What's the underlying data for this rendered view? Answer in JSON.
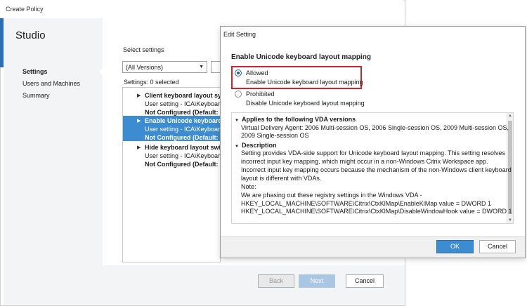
{
  "create_policy": {
    "title": "Create Policy",
    "brand": "Studio",
    "nav": [
      {
        "label": "Settings"
      },
      {
        "label": "Users and Machines"
      },
      {
        "label": "Summary"
      }
    ],
    "select_settings_label": "Select settings",
    "versions_select_value": "(All Versions)",
    "settings_count": "Settings: 0 selected",
    "list_items": [
      {
        "name": "Client keyboard layout syn",
        "sub": "User setting - ICA\\Keyboard",
        "config": "Not Configured (Default: Di"
      },
      {
        "name": "Enable Unicode keyboard",
        "sub": "User setting - ICA\\Keyboard",
        "config": "Not Configured (Default: Pr"
      },
      {
        "name": "Hide keyboard layout swit",
        "sub": "User setting - ICA\\Keyboard",
        "config": "Not Configured (Default: Di"
      }
    ],
    "buttons": {
      "back": "Back",
      "next": "Next",
      "cancel": "Cancel"
    }
  },
  "edit_setting": {
    "title": "Edit Setting",
    "heading": "Enable Unicode keyboard layout mapping",
    "options": [
      {
        "label": "Allowed",
        "description": "Enable Unicode keyboard layout mapping",
        "selected": true
      },
      {
        "label": "Prohibited",
        "description": "Disable Unicode keyboard layout mapping",
        "selected": false
      }
    ],
    "applies_heading": "Applies to the following VDA versions",
    "applies_lines": [
      "Virtual Delivery Agent: 2006 Multi-session OS, 2006 Single-session OS, 2009 Multi-session OS,",
      "2009 Single-session OS"
    ],
    "description_heading": "Description",
    "description_lines": [
      "Setting provides VDA-side support for Unicode keyboard layout mapping. This setting resolves",
      "incorrect input key mapping, which might occur in a non-Windows Citrix Workspace app.",
      "Incorrect input key mapping occurs because the mechanism of the non-Windows client keyboard",
      "layout is different with VDAs.",
      "Note:",
      "We are phasing out these registry settings in the Windows VDA -",
      "HKEY_LOCAL_MACHINE\\SOFTWARE\\Citrix\\CtxKlMap\\EnableKlMap value = DWORD 1",
      "HKEY_LOCAL_MACHINE\\SOFTWARE\\Citrix\\CtxKlMap\\DisableWindowHook value = DWORD 1"
    ],
    "buttons": {
      "ok": "OK",
      "cancel": "Cancel"
    }
  },
  "colors": {
    "accent": "#3d8cd1",
    "highlight": "#d1232a"
  }
}
